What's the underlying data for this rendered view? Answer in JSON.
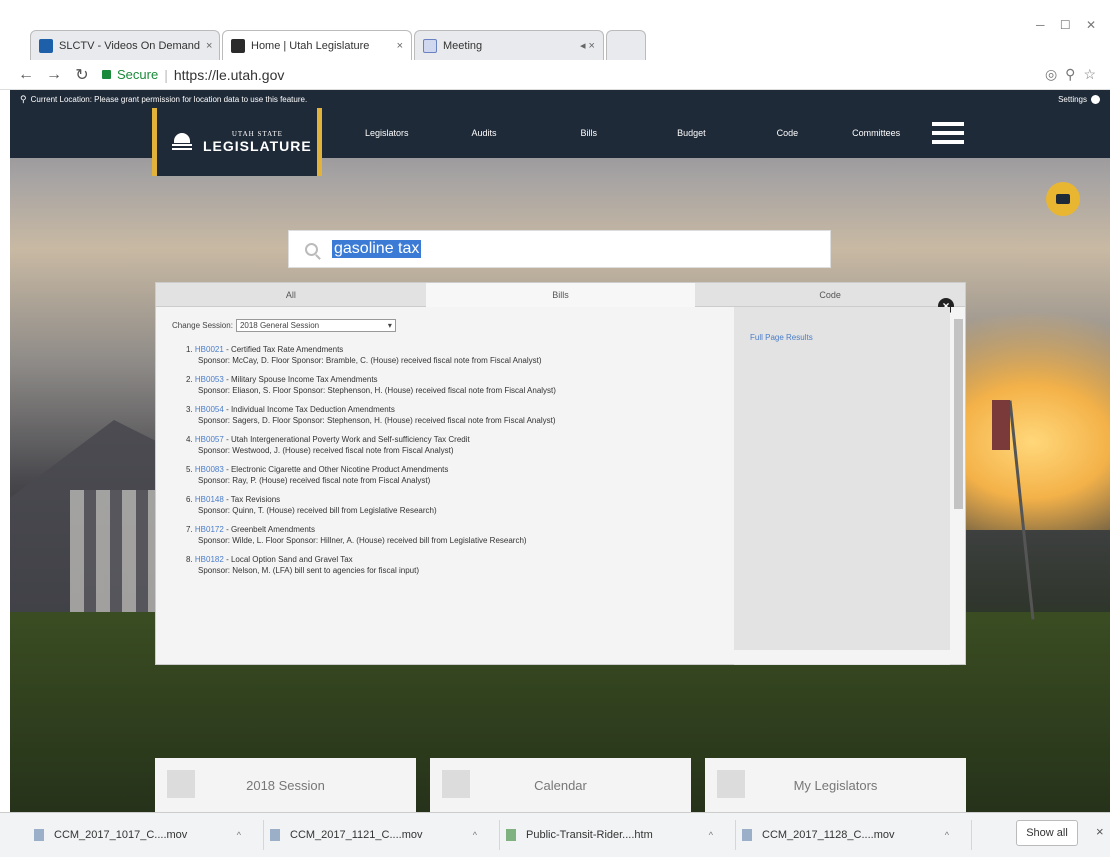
{
  "browser": {
    "tabs": [
      {
        "title": "SLCTV - Videos On Demand",
        "close": "×"
      },
      {
        "title": "Home | Utah Legislature",
        "close": "×"
      },
      {
        "title": "Meeting",
        "close": "◂ ×"
      }
    ],
    "secure_label": "Secure",
    "url": "https://le.utah.gov"
  },
  "site": {
    "top_notice": "Current Location: Please grant permission for location data to use this feature.",
    "settings_label": "Settings",
    "logo_top": "UTAH STATE",
    "logo_main": "LEGISLATURE",
    "nav": [
      "Legislators",
      "Audits",
      "Bills",
      "Budget",
      "Code",
      "Committees"
    ]
  },
  "search": {
    "value": "gasoline tax"
  },
  "panel": {
    "tabs": [
      "All",
      "Bills",
      "Code"
    ],
    "session_label": "Change Session:",
    "session_value": "2018 General Session",
    "full_page_link": "Full Page Results",
    "results": [
      {
        "num": "1.",
        "bill": "HB0021",
        "title": "- Certified Tax Rate Amendments",
        "sponsor_line": "Sponsor: McCay, D. Floor Sponsor: Bramble, C. (House) received fiscal note from Fiscal Analyst)"
      },
      {
        "num": "2.",
        "bill": "HB0053",
        "title": "- Military Spouse Income Tax Amendments",
        "sponsor_line": "Sponsor: Eliason, S. Floor Sponsor: Stephenson, H. (House) received fiscal note from Fiscal Analyst)"
      },
      {
        "num": "3.",
        "bill": "HB0054",
        "title": "- Individual Income Tax Deduction Amendments",
        "sponsor_line": "Sponsor: Sagers, D. Floor Sponsor: Stephenson, H. (House) received fiscal note from Fiscal Analyst)"
      },
      {
        "num": "4.",
        "bill": "HB0057",
        "title": "- Utah Intergenerational Poverty Work and Self-sufficiency Tax Credit",
        "sponsor_line": "Sponsor: Westwood, J. (House) received fiscal note from Fiscal Analyst)"
      },
      {
        "num": "5.",
        "bill": "HB0083",
        "title": "- Electronic Cigarette and Other Nicotine Product Amendments",
        "sponsor_line": "Sponsor: Ray, P. (House) received fiscal note from Fiscal Analyst)"
      },
      {
        "num": "6.",
        "bill": "HB0148",
        "title": "- Tax Revisions",
        "sponsor_line": "Sponsor: Quinn, T. (House) received bill from Legislative Research)"
      },
      {
        "num": "7.",
        "bill": "HB0172",
        "title": "- Greenbelt Amendments",
        "sponsor_line": "Sponsor: Wilde, L. Floor Sponsor: Hillner, A. (House) received bill from Legislative Research)"
      },
      {
        "num": "8.",
        "bill": "HB0182",
        "title": "- Local Option Sand and Gravel Tax",
        "sponsor_line": "Sponsor: Nelson, M. (LFA) bill sent to agencies for fiscal input)"
      }
    ]
  },
  "tiles": [
    "2018 Session",
    "Calendar",
    "My Legislators"
  ],
  "downloads": {
    "items": [
      "CCM_2017_1017_C....mov",
      "CCM_2017_1121_C....mov",
      "Public-Transit-Rider....htm",
      "CCM_2017_1128_C....mov"
    ],
    "show_all": "Show all",
    "close": "×"
  }
}
